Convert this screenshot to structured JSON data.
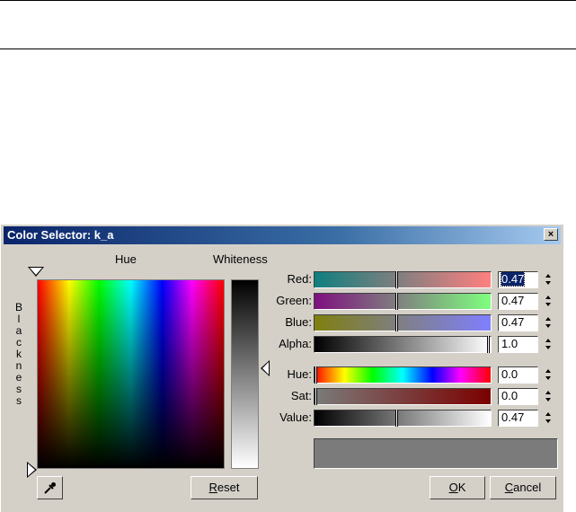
{
  "dialog": {
    "title": "Color Selector: k_a",
    "close_label": "×",
    "hue_label": "Hue",
    "whiteness_label": "Whiteness",
    "blackness_letters": [
      "B",
      "l",
      "a",
      "c",
      "k",
      "n",
      "e",
      "s",
      "s"
    ]
  },
  "rgb": [
    {
      "label": "Red:",
      "value": "0.47",
      "gradient": [
        "#0f7f7f",
        "#ff7f7f"
      ],
      "level": 0.47
    },
    {
      "label": "Green:",
      "value": "0.47",
      "gradient": [
        "#7f0f7f",
        "#7fff7f"
      ],
      "level": 0.47
    },
    {
      "label": "Blue:",
      "value": "0.47",
      "gradient": [
        "#7f7f0f",
        "#7f7fff"
      ],
      "level": 0.47
    },
    {
      "label": "Alpha:",
      "value": "1.0",
      "gradient": [
        "#000000",
        "#ffffff"
      ],
      "level": 1.0
    }
  ],
  "hsv": [
    {
      "label": "Hue:",
      "value": "0.0",
      "level": 0.0
    },
    {
      "label": "Sat:",
      "value": "0.0",
      "level": 0.0
    },
    {
      "label": "Value:",
      "value": "0.47",
      "level": 0.47
    }
  ],
  "buttons": {
    "reset_prefix": "R",
    "reset_rest": "eset",
    "ok_prefix": "O",
    "ok_rest": "K",
    "cancel_prefix": "C",
    "cancel_rest": "ancel"
  },
  "colors": {
    "preview": "#7b7b7b",
    "title_bar": "#0a246a",
    "selection": "#0a246a"
  },
  "icons": {
    "eyedropper": "eyedropper-icon"
  }
}
